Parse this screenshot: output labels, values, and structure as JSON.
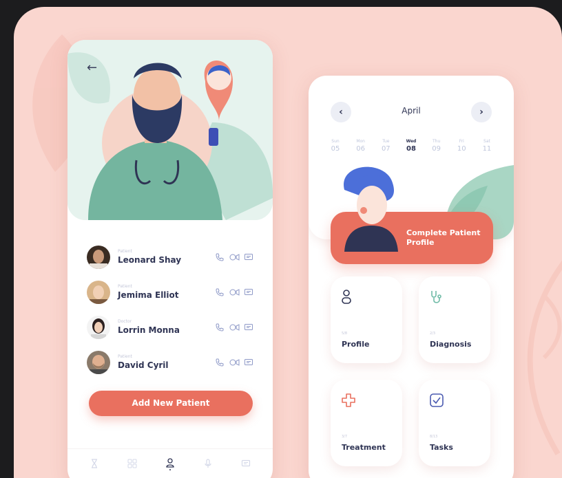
{
  "colors": {
    "board": "#fad6cf",
    "accent": "#e9705f",
    "text": "#2f3454",
    "muted": "#c3c6d8",
    "teal": "#6fbba7"
  },
  "hero": {
    "back_icon": "arrow-left-icon"
  },
  "patients": [
    {
      "role": "Patient",
      "name": "Leonard Shay"
    },
    {
      "role": "Patient",
      "name": "Jemima Elliot"
    },
    {
      "role": "Doctor",
      "name": "Lorrin Monna"
    },
    {
      "role": "Patient",
      "name": "David Cyril"
    }
  ],
  "patient_actions": [
    "phone-icon",
    "video-icon",
    "message-icon"
  ],
  "add_button": "Add New Patient",
  "tabbar": [
    "hourglass-icon",
    "grid-icon",
    "user-icon",
    "mic-icon",
    "chat-icon"
  ],
  "calendar": {
    "month": "April",
    "prev_icon": "chevron-left-icon",
    "next_icon": "chevron-right-icon",
    "days": [
      {
        "name": "Sun",
        "date": "05"
      },
      {
        "name": "Mon",
        "date": "06"
      },
      {
        "name": "Tue",
        "date": "07"
      },
      {
        "name": "Wed",
        "date": "08",
        "selected": true
      },
      {
        "name": "Thu",
        "date": "09"
      },
      {
        "name": "Fri",
        "date": "10"
      },
      {
        "name": "Sat",
        "date": "11"
      }
    ]
  },
  "cta": {
    "label": "Complete Patient Profile"
  },
  "cards": [
    {
      "count": "5/8",
      "label": "Profile",
      "icon": "user-outline-icon"
    },
    {
      "count": "2/3",
      "label": "Diagnosis",
      "icon": "stethoscope-icon"
    },
    {
      "count": "3/7",
      "label": "Treatment",
      "icon": "medical-cross-icon"
    },
    {
      "count": "8/13",
      "label": "Tasks",
      "icon": "checkbox-icon"
    }
  ]
}
